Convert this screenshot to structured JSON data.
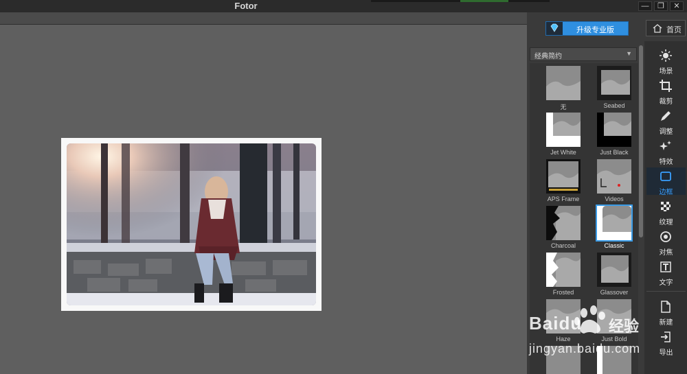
{
  "window": {
    "title": "Fotor",
    "minimize": "—",
    "maximize": "❐",
    "close": "✕"
  },
  "upgrade": {
    "label": "升级专业版",
    "icon": "diamond-icon"
  },
  "home": {
    "label": "首页",
    "icon": "home-icon"
  },
  "frames_panel": {
    "category": "经典简约",
    "items": [
      {
        "label": "无"
      },
      {
        "label": "Seabed"
      },
      {
        "label": "Jet White"
      },
      {
        "label": "Just Black"
      },
      {
        "label": "APS Frame"
      },
      {
        "label": "Videos"
      },
      {
        "label": "Charcoal"
      },
      {
        "label": "Classic",
        "selected": true
      },
      {
        "label": "Frosted"
      },
      {
        "label": "Glassover"
      },
      {
        "label": "Haze"
      },
      {
        "label": "Just Bold"
      }
    ]
  },
  "nav": {
    "items": [
      {
        "label": "场景",
        "icon": "sun-icon"
      },
      {
        "label": "裁剪",
        "icon": "crop-icon"
      },
      {
        "label": "调整",
        "icon": "pencil-icon"
      },
      {
        "label": "特效",
        "icon": "sparkle-icon"
      },
      {
        "label": "边框",
        "icon": "frame-icon",
        "active": true
      },
      {
        "label": "纹理",
        "icon": "checker-icon"
      },
      {
        "label": "对焦",
        "icon": "focus-icon"
      },
      {
        "label": "文字",
        "icon": "text-icon"
      },
      {
        "label": "新建",
        "icon": "new-file-icon"
      },
      {
        "label": "导出",
        "icon": "export-icon"
      }
    ]
  },
  "watermark": {
    "brand": "Baidu",
    "brand_cn": "经验",
    "url": "jingyan.baidu.com"
  },
  "colors": {
    "accent": "#2f8fe0",
    "active_nav": "#3aa0ff",
    "selected_border": "#3a9be6"
  }
}
